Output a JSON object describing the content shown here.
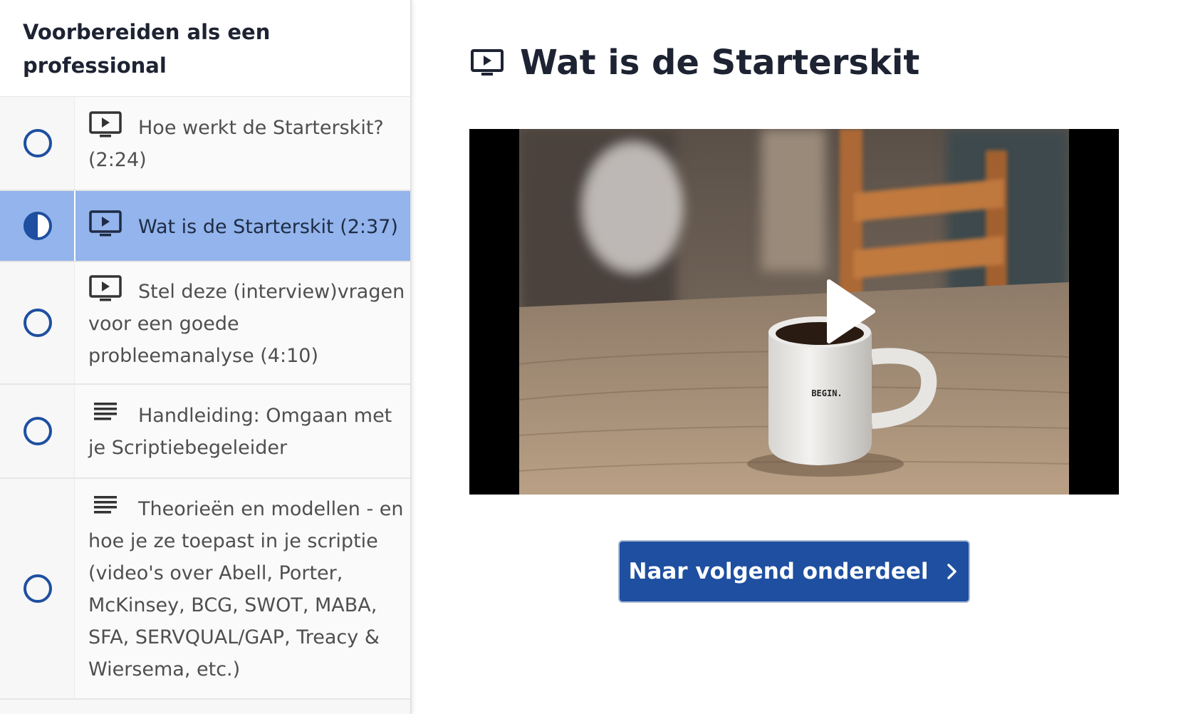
{
  "sidebar": {
    "section_title": "Voorbereiden als een professional",
    "lessons": [
      {
        "type": "video",
        "status": "not-started",
        "active": false,
        "label": "Hoe werkt de Starterskit? (2:24)"
      },
      {
        "type": "video",
        "status": "in-progress",
        "active": true,
        "label": "Wat is de Starterskit (2:37)"
      },
      {
        "type": "video",
        "status": "not-started",
        "active": false,
        "label": "Stel deze (interview)vragen voor een goede probleemanalyse (4:10)"
      },
      {
        "type": "text",
        "status": "not-started",
        "active": false,
        "label": "Handleiding: Omgaan met je Scriptiebegeleider"
      },
      {
        "type": "text",
        "status": "not-started",
        "active": false,
        "label": "Theorieën en modellen - en hoe je ze toepast in je scriptie (video's over Abell, Porter, McKinsey, BCG, SWOT, MABA, SFA, SERVQUAL/GAP, Treacy & Wiersema, etc.)"
      }
    ]
  },
  "main": {
    "lesson_title": "Wat is de Starterskit",
    "video": {
      "mug_text": "BEGIN.",
      "icon": "play-icon"
    },
    "next_button_label": "Naar volgend onderdeel"
  },
  "colors": {
    "accent": "#1e4fa0",
    "active_row": "#93b4ec",
    "status_ring": "#1e4fa0",
    "title_text": "#1e2333"
  }
}
